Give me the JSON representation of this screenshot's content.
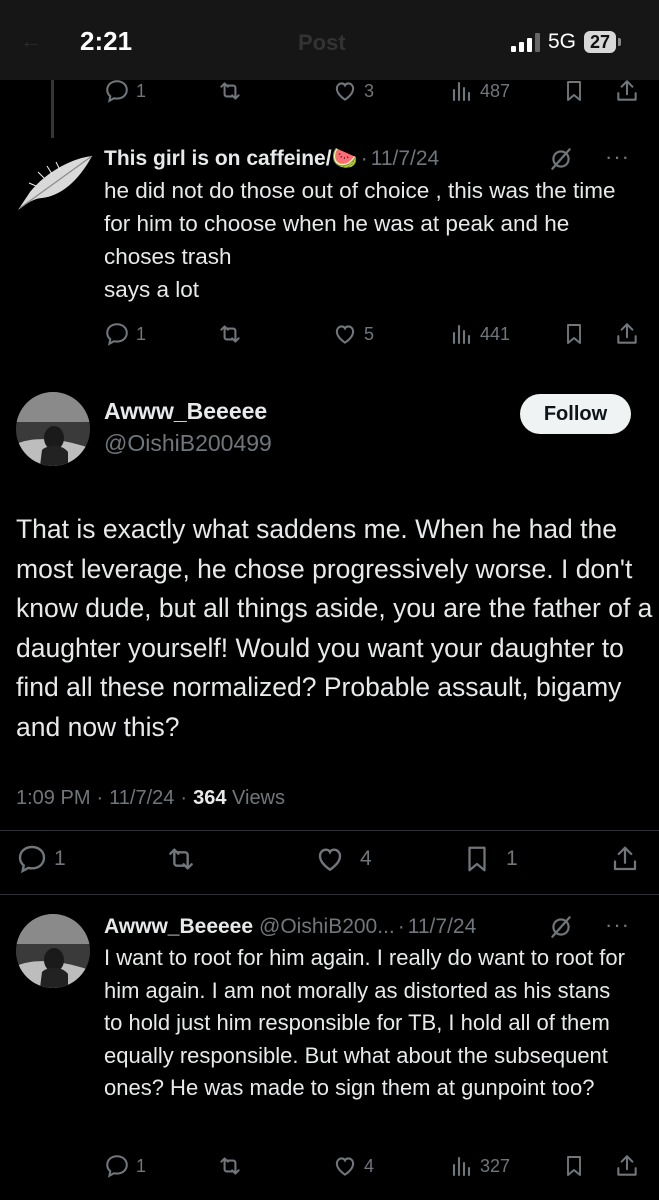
{
  "status_bar": {
    "time": "2:21",
    "title": "Post",
    "network": "5G",
    "battery": "27"
  },
  "top_actions": {
    "replies": "1",
    "reposts": "",
    "likes": "3",
    "views": "487"
  },
  "reply1": {
    "name": "This girl is on caffeine/🍉",
    "date": "11/7/24",
    "text": "he did not do those out of choice  , this was the time for him to choose when he was at peak and he choses trash\nsays a lot",
    "replies": "1",
    "likes": "5",
    "views": "441"
  },
  "main_post": {
    "name": "Awww_Beeeee",
    "handle": "@OishiB200499",
    "follow_label": "Follow",
    "text": "That is exactly what saddens me. When he had the most leverage, he chose progressively worse. I don't know dude, but all things aside, you are the father of a daughter yourself! Would you want your daughter to find all these normalized? Probable assault, bigamy and now this?",
    "time": "1:09 PM",
    "date": "11/7/24",
    "views_count": "364",
    "views_label": "Views",
    "replies": "1",
    "likes": "4",
    "bookmarks": "1"
  },
  "reply2": {
    "name": "Awww_Beeeee",
    "handle": "@OishiB200...",
    "date": "11/7/24",
    "text": "I want to root for him again. I really do want to root for him again. I am not morally as distorted as his stans to hold just him responsible for TB, I hold all of them equally responsible. But what about the subsequent ones? He was made to sign them at gunpoint too?",
    "replies": "1",
    "likes": "4",
    "views": "327"
  },
  "colors": {
    "background": "#000000",
    "text": "#e7e9ea",
    "muted": "#71767b",
    "follow_bg": "#eff3f4"
  }
}
